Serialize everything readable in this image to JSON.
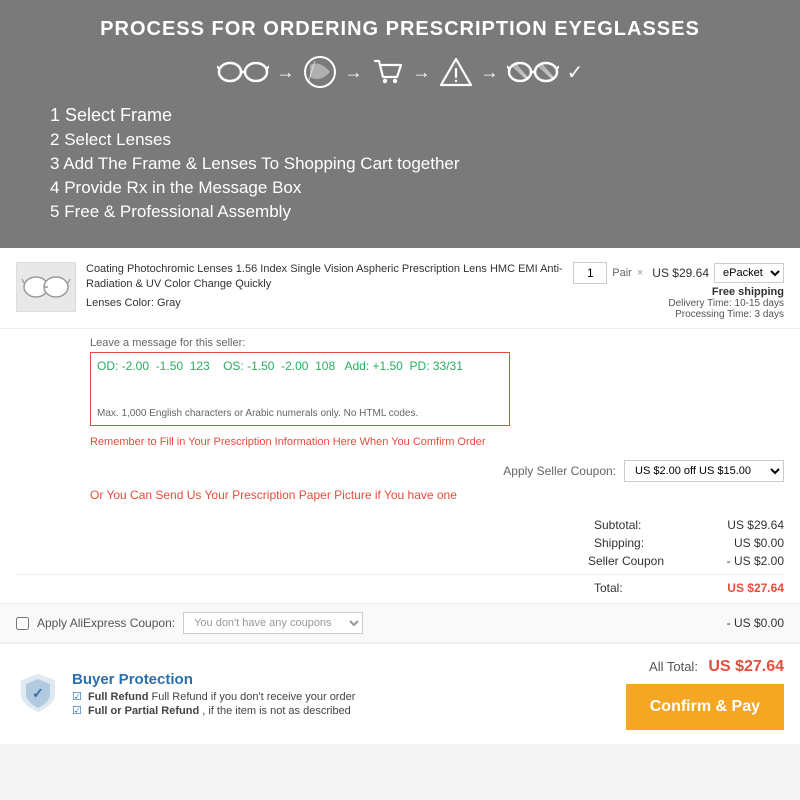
{
  "header": {
    "title": "PROCESS FOR ORDERING PRESCRIPTION EYEGLASSES",
    "steps": [
      {
        "label": "Select Frame",
        "number": "1"
      },
      {
        "label": "Select Lenses",
        "number": "2"
      },
      {
        "label": "Add The Frame & Lenses To Shopping Cart together",
        "number": "3"
      },
      {
        "label": "Provide Rx in the Message Box",
        "number": "4"
      },
      {
        "label": "Free & Professional Assembly",
        "number": "5"
      }
    ]
  },
  "product": {
    "title": "Coating Photochromic Lenses 1.56 Index Single Vision Aspheric Prescription Lens HMC EMI Anti-Radiation & UV Color Change Quickly",
    "lenses_color_label": "Lenses Color:",
    "lenses_color_value": "Gray",
    "quantity": "1",
    "unit": "Pair",
    "price": "US $29.64",
    "shipping_option": "ePacket",
    "free_shipping": "Free shipping",
    "delivery_time": "Delivery Time: 10-15 days",
    "processing_time": "Processing Time: 3 days"
  },
  "message": {
    "label": "Leave a message for this seller:",
    "value": "OD: -2.00  -1.50  123    OS: -1.50  -2.00  108   Add: +1.50  PD: 33/31",
    "hint": "Max. 1,000 English characters or Arabic numerals only. No HTML codes."
  },
  "reminder": {
    "text1": "Remember to Fill in Your Prescription Information Here When You Comfirm Order",
    "text2": "Or You Can Send Us Your Prescription Paper Picture if You have one"
  },
  "seller_coupon": {
    "label": "Apply Seller Coupon:",
    "value": "US $2.00 off US $15.00"
  },
  "summary": {
    "subtotal_label": "Subtotal:",
    "subtotal_value": "US $29.64",
    "shipping_label": "Shipping:",
    "shipping_value": "US $0.00",
    "seller_coupon_label": "Seller Coupon",
    "seller_coupon_value": "- US $2.00",
    "total_label": "Total:",
    "total_value": "US $27.64"
  },
  "ali_coupon": {
    "label": "Apply AliExpress Coupon:",
    "placeholder": "You don't have any coupons",
    "amount": "- US $0.00"
  },
  "footer": {
    "buyer_protection_title": "Buyer Protection",
    "bp_item1": "Full Refund if you don't receive your order",
    "bp_item2": "Full or Partial Refund , if the item is not as described",
    "all_total_label": "All Total:",
    "all_total_value": "US $27.64",
    "confirm_button": "Confirm & Pay"
  }
}
